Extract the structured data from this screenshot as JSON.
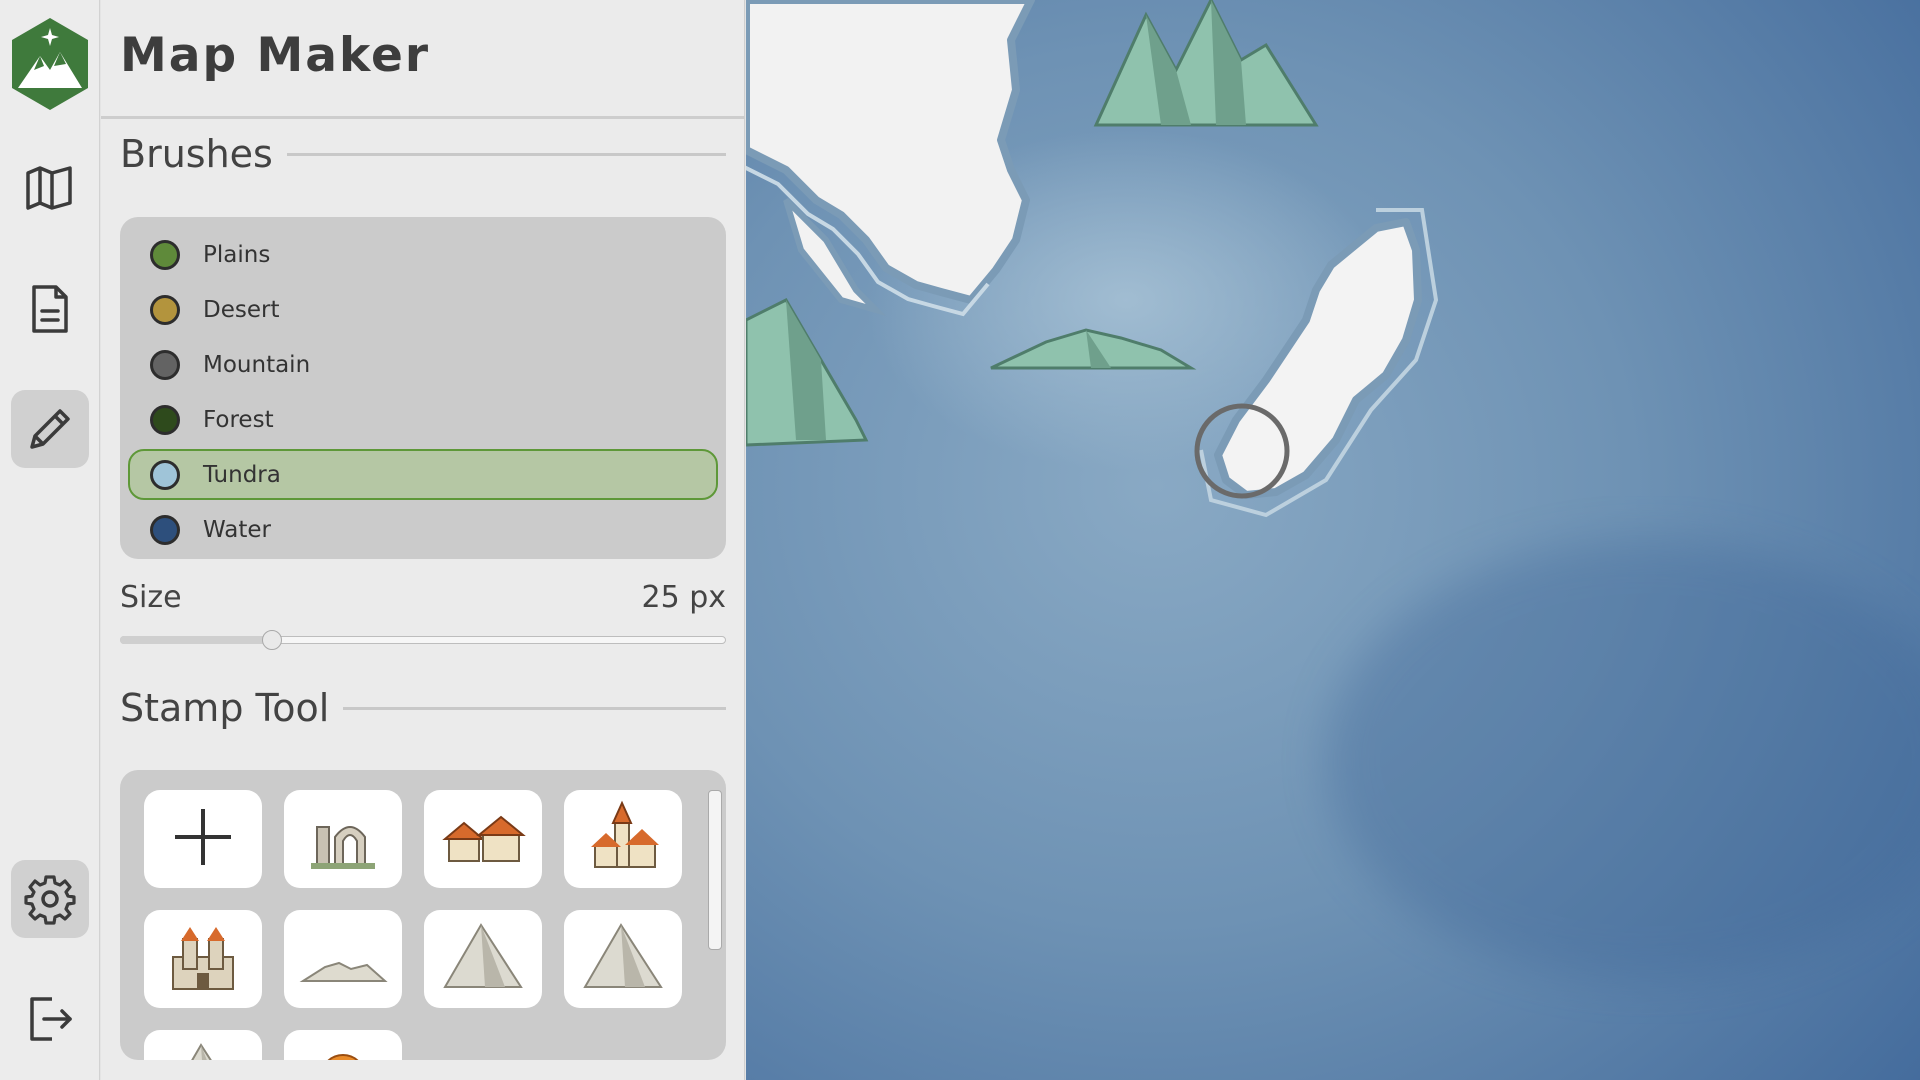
{
  "app": {
    "title": "Map Maker"
  },
  "nav": {
    "items": [
      {
        "name": "map",
        "icon": "map-icon"
      },
      {
        "name": "document",
        "icon": "document-icon"
      },
      {
        "name": "edit",
        "icon": "pencil-icon",
        "active": true
      },
      {
        "name": "settings",
        "icon": "gear-icon"
      },
      {
        "name": "logout",
        "icon": "logout-icon"
      }
    ]
  },
  "brushes": {
    "heading": "Brushes",
    "items": [
      {
        "label": "Plains",
        "color": "#5f8a3a"
      },
      {
        "label": "Desert",
        "color": "#b3943d"
      },
      {
        "label": "Mountain",
        "color": "#636363"
      },
      {
        "label": "Forest",
        "color": "#2e4a1c"
      },
      {
        "label": "Tundra",
        "color": "#9fc4d8",
        "selected": true
      },
      {
        "label": "Water",
        "color": "#2d4f7c"
      }
    ],
    "size_label": "Size",
    "size_value": "25 px",
    "size_fraction": 0.25
  },
  "stamps": {
    "heading": "Stamp Tool",
    "items": [
      {
        "name": "add",
        "icon": "plus-icon"
      },
      {
        "name": "ruins",
        "icon": "ruins-stamp-icon"
      },
      {
        "name": "village",
        "icon": "village-stamp-icon"
      },
      {
        "name": "town",
        "icon": "town-stamp-icon"
      },
      {
        "name": "castle",
        "icon": "castle-stamp-icon"
      },
      {
        "name": "hills",
        "icon": "hills-stamp-icon"
      },
      {
        "name": "mountain",
        "icon": "mountain-stamp-icon"
      },
      {
        "name": "mountain-2",
        "icon": "mountain-stamp-icon"
      },
      {
        "name": "mountains-partial",
        "icon": "mountain-stamp-icon"
      },
      {
        "name": "tree-partial",
        "icon": "tree-stamp-icon"
      }
    ]
  },
  "colors": {
    "accent": "#5e9838",
    "logo": "#3f7a3c",
    "water": "#5c84a8",
    "tundra": "#f2f2f2",
    "mountain_stamp": "#8fc2ad"
  }
}
